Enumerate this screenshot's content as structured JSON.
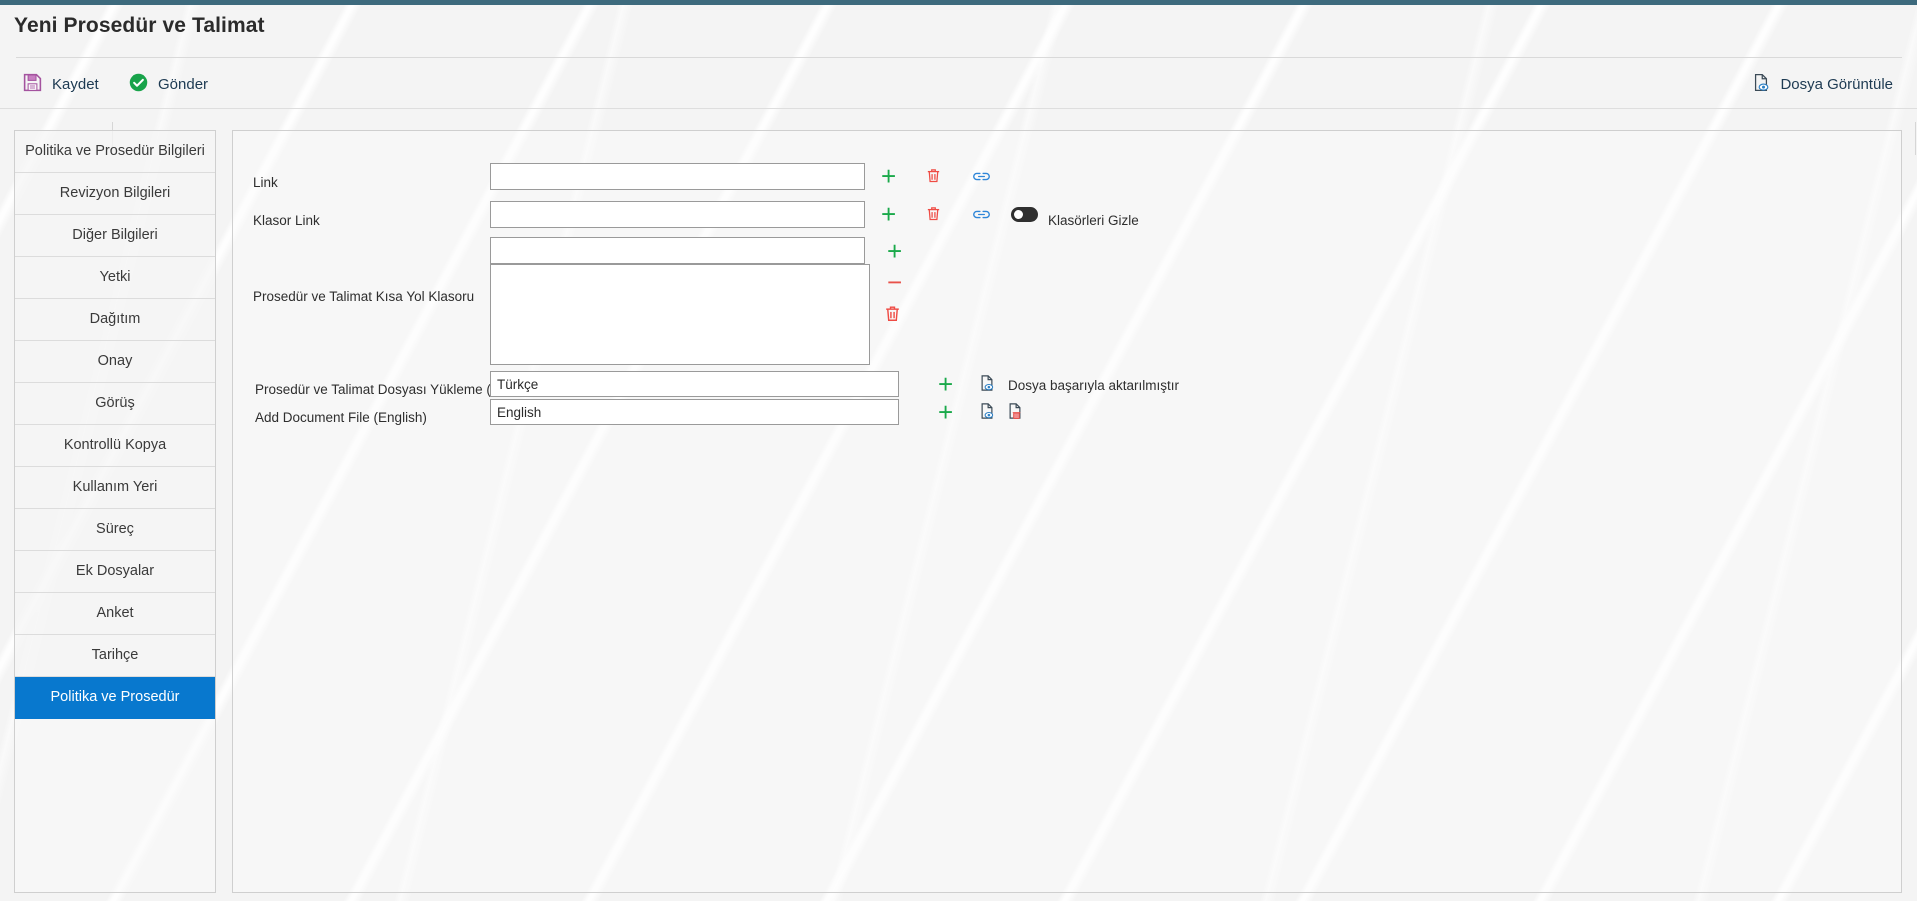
{
  "window": {
    "title": "Yeni Prosedür ve Talimat",
    "accent_color": "#0878ce",
    "top_strip_color": "#3d6a7d"
  },
  "toolbar": {
    "save_label": "Kaydet",
    "send_label": "Gönder",
    "view_file_label": "Dosya Görüntüle",
    "save_icon": "floppy-disk-icon",
    "send_icon": "check-circle-icon",
    "view_file_icon": "document-eye-icon"
  },
  "sidebar": {
    "items": [
      {
        "label": "Politika ve Prosedür Bilgileri",
        "active": false
      },
      {
        "label": "Revizyon Bilgileri",
        "active": false
      },
      {
        "label": "Diğer Bilgileri",
        "active": false
      },
      {
        "label": "Yetki",
        "active": false
      },
      {
        "label": "Dağıtım",
        "active": false
      },
      {
        "label": "Onay",
        "active": false
      },
      {
        "label": "Görüş",
        "active": false
      },
      {
        "label": "Kontrollü Kopya",
        "active": false
      },
      {
        "label": "Kullanım Yeri",
        "active": false
      },
      {
        "label": "Süreç",
        "active": false
      },
      {
        "label": "Ek Dosyalar",
        "active": false
      },
      {
        "label": "Anket",
        "active": false
      },
      {
        "label": "Tarihçe",
        "active": false
      },
      {
        "label": "Politika ve Prosedür",
        "active": true
      }
    ]
  },
  "form": {
    "link_row": {
      "label": "Link",
      "value": "",
      "placeholder": "",
      "add_icon": "plus-icon",
      "delete_icon": "trash-icon",
      "chain_icon": "link-chain-icon"
    },
    "folder_link_row": {
      "label": "Klasor Link",
      "value": "",
      "placeholder": "",
      "add_icon": "plus-icon",
      "delete_icon": "trash-icon",
      "chain_icon": "link-chain-icon",
      "toggle_label": "Klasörleri Gizle",
      "toggle_state": "off"
    },
    "shortcut_folder_row": {
      "label": "Prosedür ve Talimat Kısa Yol Klasoru",
      "input_value": "",
      "list_value": "",
      "add_icon": "plus-icon",
      "remove_icon": "minus-icon",
      "delete_icon": "trash-icon"
    },
    "upload_tr_row": {
      "label": "Prosedür ve Talimat Dosyası Yükleme (Türkçe)",
      "value": "Türkçe",
      "add_icon": "plus-icon",
      "preview_icon": "document-eye-icon",
      "status_message": "Dosya başarıyla aktarılmıştır"
    },
    "upload_en_row": {
      "label": "Add Document File (English)",
      "value": "English",
      "add_icon": "plus-icon",
      "preview_icon": "document-eye-icon",
      "delete_icon": "document-trash-icon"
    }
  }
}
